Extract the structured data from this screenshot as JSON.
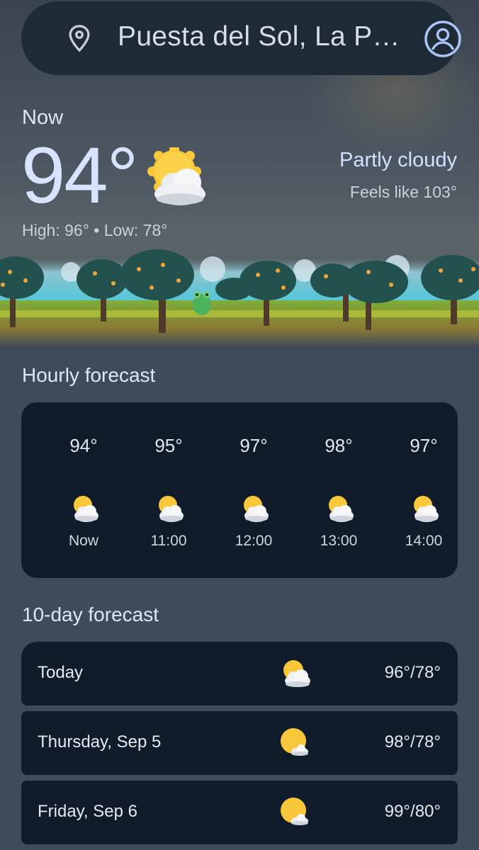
{
  "search": {
    "location": "Puesta del Sol, La P…",
    "icons": {
      "left": "location-pin-icon",
      "right": "account-icon"
    }
  },
  "current": {
    "now_label": "Now",
    "temperature": "94°",
    "condition": "Partly cloudy",
    "feels_like": "Feels like 103°",
    "high_low": "High: 96° • Low: 78°",
    "icon": "partly-cloudy-icon"
  },
  "hourly": {
    "title": "Hourly forecast",
    "items": [
      {
        "temp": "94°",
        "time": "Now",
        "icon": "partly-cloudy-icon"
      },
      {
        "temp": "95°",
        "time": "11:00",
        "icon": "partly-cloudy-icon"
      },
      {
        "temp": "97°",
        "time": "12:00",
        "icon": "partly-cloudy-icon"
      },
      {
        "temp": "98°",
        "time": "13:00",
        "icon": "partly-cloudy-icon"
      },
      {
        "temp": "97°",
        "time": "14:00",
        "icon": "partly-cloudy-icon"
      }
    ]
  },
  "daily": {
    "title": "10-day forecast",
    "items": [
      {
        "day": "Today",
        "range": "96°/78°",
        "icon": "partly-cloudy-icon"
      },
      {
        "day": "Thursday, Sep 5",
        "range": "98°/78°",
        "icon": "mostly-sunny-icon"
      },
      {
        "day": "Friday, Sep 6",
        "range": "99°/80°",
        "icon": "mostly-sunny-icon"
      }
    ]
  },
  "colors": {
    "background": "#3f4a5a",
    "card": "#101c29",
    "search_bar": "#1e2a36",
    "accent_text": "#d8e4ff",
    "sun": "#f9c935"
  }
}
